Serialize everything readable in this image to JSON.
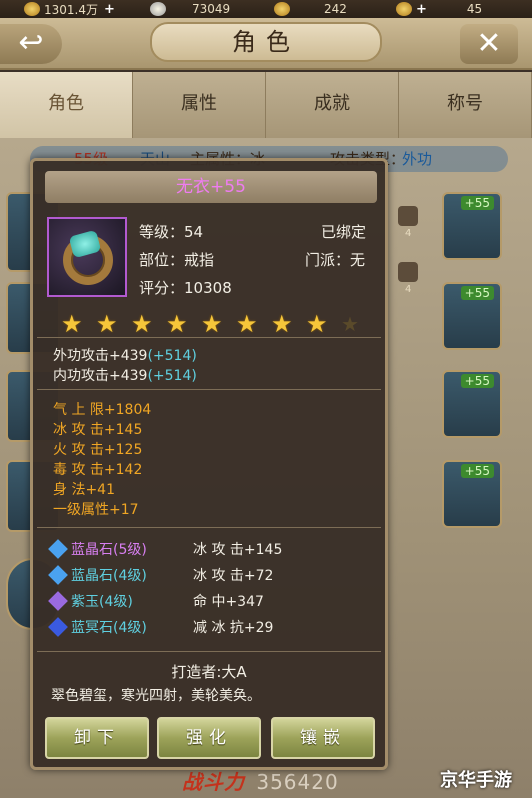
{
  "topbar": {
    "silver": "1301.4万",
    "gold": "73049",
    "jade": "242",
    "tokens": "45",
    "plus": "+"
  },
  "header": {
    "title": "角色",
    "back_icon": "back-arrow-icon",
    "close_icon": "close-icon"
  },
  "tabs": [
    {
      "label": "角色",
      "active": true
    },
    {
      "label": "属性",
      "active": false
    },
    {
      "label": "成就",
      "active": false
    },
    {
      "label": "称号",
      "active": false
    }
  ],
  "info": {
    "level": "55级",
    "sect": "天山",
    "main_attr": "主属性：冰",
    "attack_label": "攻击类型：",
    "attack_type": "外功"
  },
  "right_slots": [
    {
      "badge": "+55",
      "count": "4"
    },
    {
      "badge": "+55",
      "count": "4"
    },
    {
      "badge": "+55"
    },
    {
      "badge": "+55"
    }
  ],
  "footer": {
    "score_label": "战斗力",
    "score": "356420",
    "watermark": "京华手游"
  },
  "item": {
    "name": "无衣+55",
    "level_label": "等级：",
    "level": "54",
    "bound": "已绑定",
    "slot_label": "部位：",
    "slot": "戒指",
    "sect_label": "门派：",
    "sect": "无",
    "score_label": "评分：",
    "score": "10308",
    "stars_filled": 8,
    "stars_total": 9,
    "attrs": [
      {
        "base": "外功攻击+439",
        "bonus": "(+514)"
      },
      {
        "base": "内功攻击+439",
        "bonus": "(+514)"
      }
    ],
    "extras": [
      "气 上 限+1804",
      "冰 攻 击+145",
      "火 攻 击+125",
      "毒 攻 击+142",
      "身  法+41",
      "一级属性+17"
    ],
    "gems": [
      {
        "name": "蓝晶石(5级)",
        "stat": "冰 攻 击+145",
        "color": "#d77ff0",
        "icon_color": "#4aa2f0"
      },
      {
        "name": "蓝晶石(4级)",
        "stat": "冰 攻 击+72",
        "color": "#5fd0e0",
        "icon_color": "#4aa2f0"
      },
      {
        "name": "紫玉(4级)",
        "stat": "命  中+347",
        "color": "#5fd0e0",
        "icon_color": "#9a6ae0"
      },
      {
        "name": "蓝冥石(4级)",
        "stat": "减 冰 抗+29",
        "color": "#5fd0e0",
        "icon_color": "#3a5ae0"
      }
    ],
    "maker": "打造者:大A",
    "flavor": "翠色碧玺，寒光四射，美轮美奂。"
  },
  "buttons": {
    "unequip": "卸下",
    "enhance": "强化",
    "inlay": "镶嵌"
  }
}
